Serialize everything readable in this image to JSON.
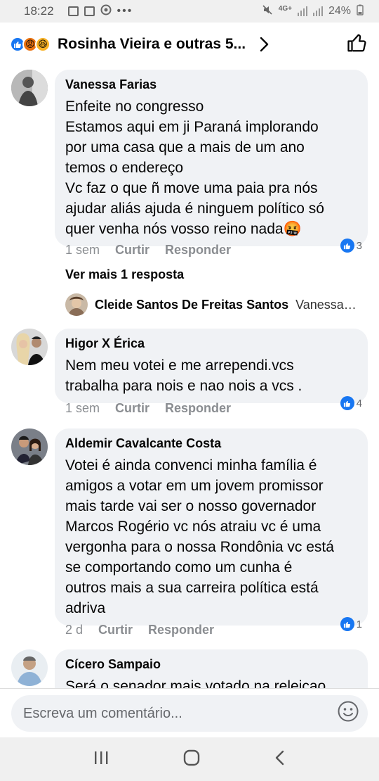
{
  "status": {
    "time": "18:22",
    "network": "4G+",
    "battery": "24%"
  },
  "header": {
    "title": "Rosinha Vieira e outras 5..."
  },
  "comments": [
    {
      "name": "Vanessa Farias",
      "lines": [
        "Enfeite no congresso",
        "Estamos aqui em ji Paraná implorando",
        "por uma casa que a mais de um ano",
        "temos o endereço",
        "Vc faz o que ñ move uma paia pra nós",
        "ajudar aliás ajuda é ninguem político só",
        "quer venha nós vosso reino nada🤬"
      ],
      "time": "1 sem",
      "like": "Curtir",
      "reply": "Responder",
      "reactions": "3",
      "more_replies": "Ver mais 1 resposta",
      "reply_preview": {
        "name": "Cleide Santos De Freitas Santos",
        "snippet": "Vanessa…"
      }
    },
    {
      "name": "Higor X Érica",
      "lines": [
        "Nem meu votei e me arrependi.vcs",
        "trabalha para nois e nao nois a vcs ."
      ],
      "time": "1 sem",
      "like": "Curtir",
      "reply": "Responder",
      "reactions": "4"
    },
    {
      "name": "Aldemir Cavalcante Costa",
      "lines": [
        "Votei é ainda convenci minha família é",
        "amigos a votar em um jovem promissor",
        "mais tarde vai ser o nosso governador",
        "Marcos Rogério vc nós atraiu vc é uma",
        "vergonha para o nossa Rondônia vc está",
        "se comportando como um cunha é",
        "outros mais a sua carreira política está",
        "adriva"
      ],
      "time": "2 d",
      "like": "Curtir",
      "reply": "Responder",
      "reactions": "1"
    },
    {
      "name": "Cícero Sampaio",
      "lines": [
        "Será o senador mais votado na releicao"
      ]
    }
  ],
  "input": {
    "placeholder": "Escreva um comentário..."
  },
  "colors": {
    "accent": "#1877f2",
    "bubble": "#f0f2f5",
    "muted": "#8a8d91"
  }
}
